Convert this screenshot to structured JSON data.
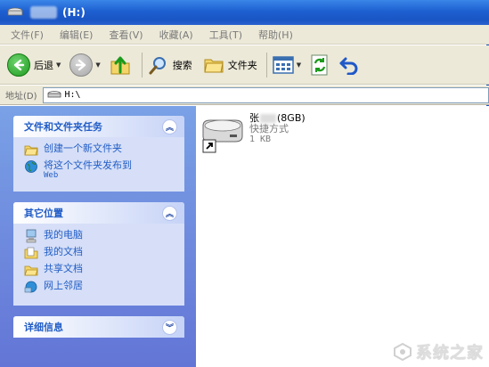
{
  "window": {
    "title": "(H:)"
  },
  "menu": [
    "文件(F)",
    "编辑(E)",
    "查看(V)",
    "收藏(A)",
    "工具(T)",
    "帮助(H)"
  ],
  "toolbar": {
    "back_label": "后退",
    "search_label": "搜索",
    "folders_label": "文件夹"
  },
  "address": {
    "label": "地址(D)",
    "value": "H:\\"
  },
  "tasks_panel": {
    "title": "文件和文件夹任务",
    "items": [
      {
        "label": "创建一个新文件夹",
        "icon": "new-folder-icon"
      },
      {
        "label": "将这个文件夹发布到",
        "sub": "Web",
        "icon": "publish-web-icon"
      }
    ]
  },
  "places_panel": {
    "title": "其它位置",
    "items": [
      {
        "label": "我的电脑",
        "icon": "my-computer-icon"
      },
      {
        "label": "我的文档",
        "icon": "my-documents-icon"
      },
      {
        "label": "共享文档",
        "icon": "shared-documents-icon"
      },
      {
        "label": "网上邻居",
        "icon": "network-places-icon"
      }
    ]
  },
  "details_panel": {
    "title": "详细信息"
  },
  "file": {
    "name_prefix": "张",
    "name_suffix": "(8GB)",
    "type": "快捷方式",
    "size": "1 KB",
    "icon": "drive-shortcut-icon"
  },
  "watermark": {
    "text": "系统之家"
  },
  "colors": {
    "titlebar": "#1d5fd0",
    "task_link": "#215dc6",
    "leftpane": "#7aa1e6"
  }
}
